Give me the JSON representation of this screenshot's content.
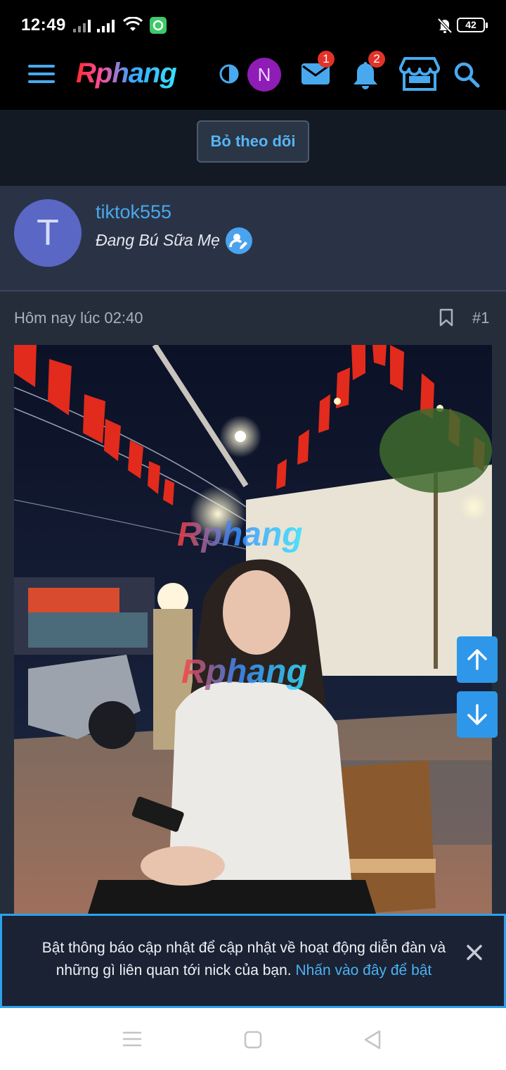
{
  "status_bar": {
    "time": "12:49",
    "battery": "42"
  },
  "header": {
    "logo": "Rphang",
    "user_initial": "N",
    "mail_badge": "1",
    "notification_badge": "2"
  },
  "follow": {
    "unfollow_label": "Bỏ theo dõi"
  },
  "user": {
    "avatar_initial": "T",
    "username": "tiktok555",
    "title": "Đang Bú Sữa Mẹ"
  },
  "post": {
    "time": "Hôm nay lúc 02:40",
    "number": "#1",
    "watermark": "Rphang"
  },
  "notice": {
    "text": "Bật thông báo cập nhật để cập nhật về hoạt động diễn đàn và những gì liên quan tới nick của bạn.",
    "link": "Nhấn vào đây để bật"
  },
  "colors": {
    "accent": "#2ca1ec",
    "badge": "#e2332a",
    "card_bg": "#2a3346",
    "post_bg": "#252d3a"
  },
  "icons": [
    "menu-icon",
    "theme-toggle-icon",
    "mail-icon",
    "bell-icon",
    "store-icon",
    "search-icon",
    "verified-icon",
    "bookmark-icon",
    "arrow-up-icon",
    "arrow-down-icon",
    "close-icon"
  ]
}
